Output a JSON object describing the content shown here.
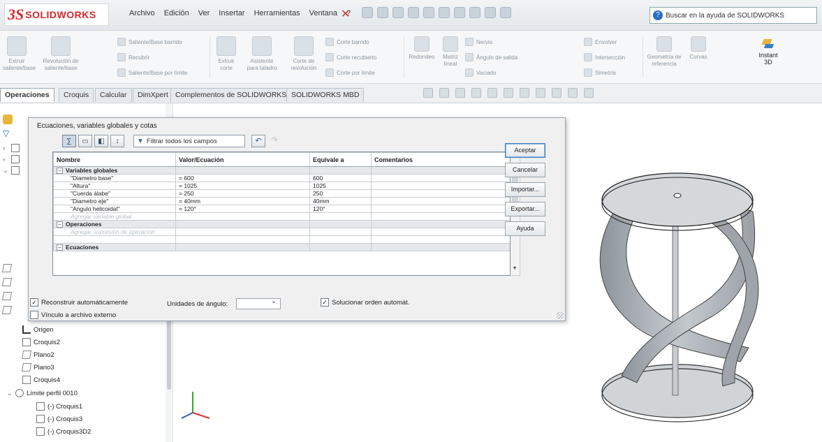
{
  "app": {
    "brand_ds": "3S",
    "brand_name": "SOLIDWORKS"
  },
  "menu": [
    "Archivo",
    "Edición",
    "Ver",
    "Insertar",
    "Herramientas",
    "Ventana",
    "?"
  ],
  "search": {
    "placeholder": "Buscar en la ayuda de SOLIDWORKS"
  },
  "ribbon": {
    "items": [
      "Extruir saliente/base",
      "Revolución de saliente/base",
      "Saliente/Base barrido",
      "Recubrir",
      "Saliente/Base por límite",
      "Extruir corte",
      "Asistente para taladro",
      "Corte de revolución",
      "Corte barrido",
      "Corte recubierto",
      "Corte por límite",
      "Redondeo",
      "Matriz lineal",
      "Nervio",
      "Ángulo de salida",
      "Vaciado",
      "Envolver",
      "Intersección",
      "Simetría",
      "Geometría de referencia",
      "Curvas"
    ],
    "instant3d": "Instant 3D"
  },
  "tabs": [
    "Operaciones",
    "Croquis",
    "Calcular",
    "DimXpert",
    "Complementos de SOLIDWORKS",
    "SOLIDWORKS MBD"
  ],
  "active_tab": "Operaciones",
  "tree": {
    "items": [
      "Origen",
      "Croquis2",
      "Plano2",
      "Plano3",
      "Croquis4",
      "Límite perfil 0010",
      "(-) Croquis1",
      "(-) Croquis3",
      "(-) Croquis3D2"
    ]
  },
  "dialog": {
    "title": "Ecuaciones, variables globales y cotas",
    "filter": "Filtrar todos los campos",
    "columns": {
      "name": "Nombre",
      "value": "Valor/Ecuación",
      "equals": "Equivale a",
      "comments": "Comentarios"
    },
    "sections": {
      "globals": "Variables globales",
      "ops": "Operaciones",
      "eqs": "Ecuaciones"
    },
    "rows": [
      {
        "name": "\"Diametro base\"",
        "value": "= 600",
        "equals": "600"
      },
      {
        "name": "\"Altura\"",
        "value": "= 1025",
        "equals": "1025"
      },
      {
        "name": "\"Cuerda álabe\"",
        "value": "= 250",
        "equals": "250"
      },
      {
        "name": "\"Diametro eje\"",
        "value": "= 40mm",
        "equals": "40mm"
      },
      {
        "name": "\"Angulo helicoidal\"",
        "value": "= 120°",
        "equals": "120°"
      }
    ],
    "add_global": "Agregar variable global",
    "add_suppression": "Agregar supresión de operación",
    "buttons": {
      "ok": "Aceptar",
      "cancel": "Cancelar",
      "import": "Importar...",
      "export": "Exportar...",
      "help": "Ayuda"
    },
    "rebuild_label": "Reconstruir automáticamente",
    "link_label": "Vínculo a archivo externo",
    "angle_units_label": "Unidades de ángulo:",
    "solve_order_label": "Solucionar orden automát."
  },
  "colors": {
    "accent": "#d9262b",
    "link": "#2a6cc7"
  }
}
